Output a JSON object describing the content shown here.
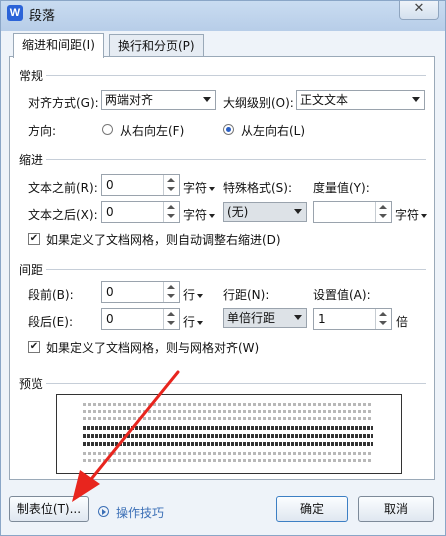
{
  "window": {
    "title": "段落",
    "app_icon": "wps-writer-icon",
    "close_glyph": "✕"
  },
  "tabs": [
    {
      "label": "缩进和间距(I)",
      "active": true
    },
    {
      "label": "换行和分页(P)",
      "active": false
    }
  ],
  "general": {
    "section": "常规",
    "alignment_label": "对齐方式(G):",
    "alignment_value": "两端对齐",
    "outline_label": "大纲级别(O):",
    "outline_value": "正文文本",
    "direction_label": "方向:",
    "rtl_label": "从右向左(F)",
    "ltr_label": "从左向右(L)",
    "direction_selected": "ltr"
  },
  "indent": {
    "section": "缩进",
    "before_label": "文本之前(R):",
    "before_value": "0",
    "before_unit": "字符",
    "after_label": "文本之后(X):",
    "after_value": "0",
    "after_unit": "字符",
    "special_label": "特殊格式(S):",
    "special_value": "(无)",
    "measure_label": "度量值(Y):",
    "measure_value": "",
    "measure_unit": "字符",
    "auto_adjust_label": "如果定义了文档网格，则自动调整右缩进(D)",
    "auto_adjust_checked": true
  },
  "spacing": {
    "section": "间距",
    "before_label": "段前(B):",
    "before_value": "0",
    "before_unit": "行",
    "after_label": "段后(E):",
    "after_value": "0",
    "after_unit": "行",
    "line_label": "行距(N):",
    "line_value": "单倍行距",
    "setting_label": "设置值(A):",
    "setting_value": "1",
    "setting_unit": "倍",
    "snap_grid_label": "如果定义了文档网格，则与网格对齐(W)",
    "snap_grid_checked": true
  },
  "preview": {
    "section": "预览"
  },
  "footer": {
    "tabs_button": "制表位(T)...",
    "tips_link": "操作技巧",
    "ok_button": "确定",
    "cancel_button": "取消"
  },
  "colors": {
    "accent": "#2a5fc4",
    "annotation_arrow": "#e8251e",
    "link": "#3b6fb6"
  }
}
